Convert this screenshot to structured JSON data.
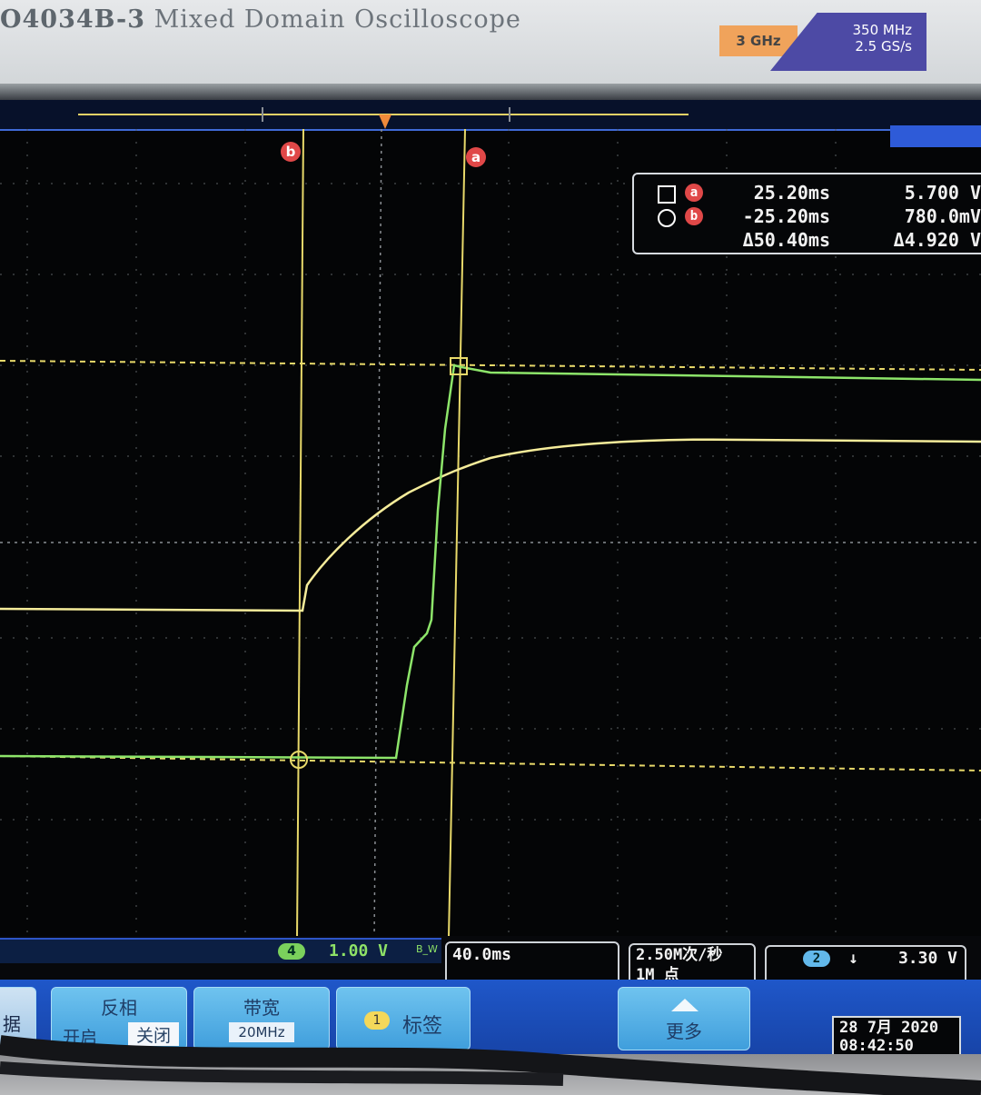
{
  "instrument": {
    "model": "O4034B-3",
    "title": "Mixed Domain Oscilloscope",
    "spec_ghz": "3 GHz",
    "spec_bandwidth": "350 MHz",
    "spec_samplerate": "2.5 GS/s"
  },
  "cursors": {
    "a_label": "a",
    "b_label": "b"
  },
  "readout": {
    "a_time": "25.20ms",
    "a_value": "5.700 V",
    "b_time": "-25.20ms",
    "b_value": "780.0mV",
    "delta_time": "Δ50.40ms",
    "delta_value": "Δ4.920 V"
  },
  "channel_bar": {
    "channel": "4",
    "volts_per_div": "1.00 V",
    "bw_flag": "B_W"
  },
  "timebase": "40.0ms",
  "acquisition": {
    "rate": "2.50M次/秒",
    "points": "1M 点"
  },
  "trigger": {
    "channel": "2",
    "edge": "↓",
    "level": "3.30 V"
  },
  "softkeys": {
    "edge_partial": "据",
    "invert_title": "反相",
    "invert_on": "开启",
    "invert_off": "关闭",
    "bandwidth_title": "带宽",
    "bandwidth_value": "20MHz",
    "label_number": "1",
    "label_title": "标签",
    "more_title": "更多"
  },
  "datetime": {
    "date": "28 7月 2020",
    "time": "08:42:50"
  },
  "colors": {
    "trace_yellow": "#f5ec9a",
    "trace_green": "#8de56a",
    "cursor_yellow": "#e8d96a",
    "screen_bg": "#040506",
    "ui_blue": "#1f57c9"
  }
}
